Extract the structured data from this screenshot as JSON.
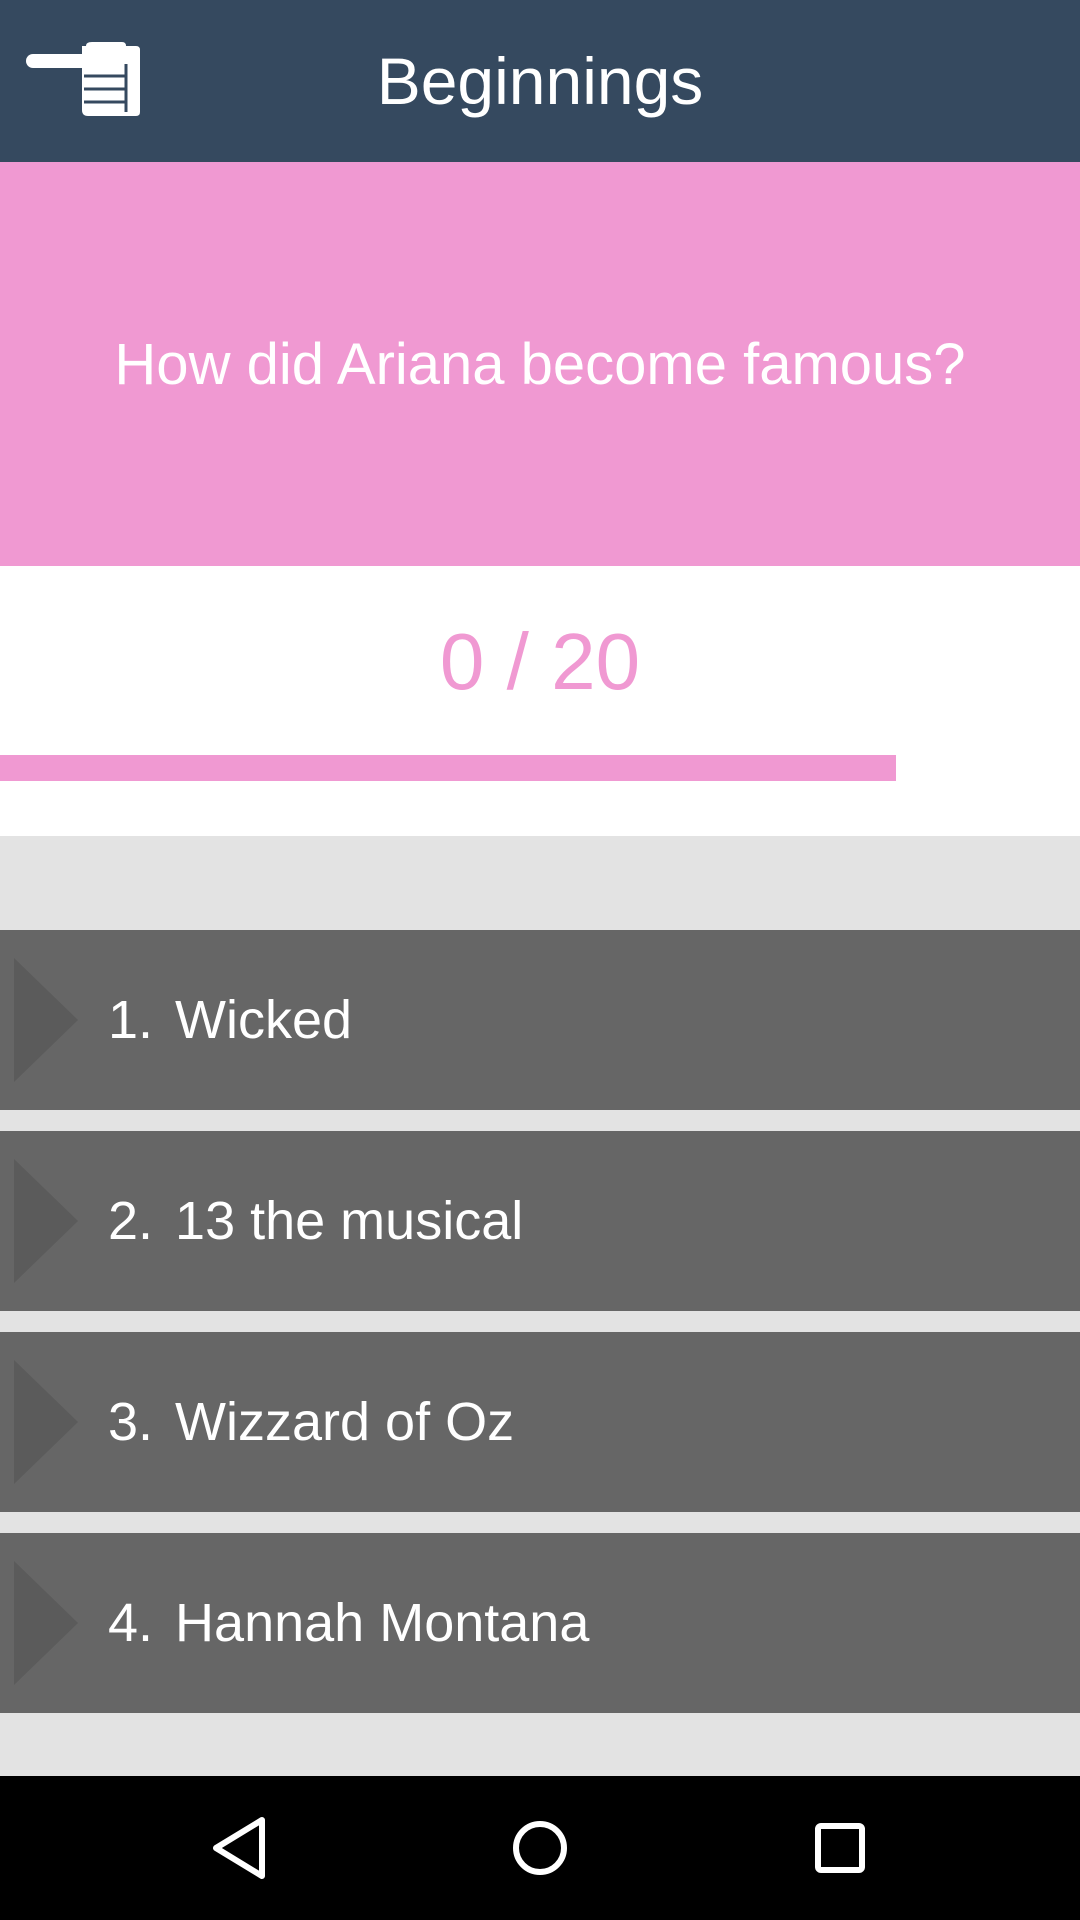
{
  "header": {
    "title": "Beginnings",
    "back_icon": "pointing-hand-left-icon"
  },
  "question": {
    "text": "How did Ariana become famous?"
  },
  "progress": {
    "score_text": "0 / 20",
    "fraction": 0.83
  },
  "answers": [
    {
      "number": "1.",
      "label": "Wicked"
    },
    {
      "number": "2.",
      "label": "13 the musical"
    },
    {
      "number": "3.",
      "label": "Wizzard of Oz"
    },
    {
      "number": "4.",
      "label": "Hannah Montana"
    }
  ],
  "navbar": {
    "icons": [
      "back-triangle-icon",
      "home-circle-icon",
      "recents-square-icon"
    ]
  },
  "colors": {
    "header": "#35495f",
    "accent_pink": "#f099d2",
    "answer_bg": "#666666",
    "page_bg": "#e3e3e3"
  }
}
